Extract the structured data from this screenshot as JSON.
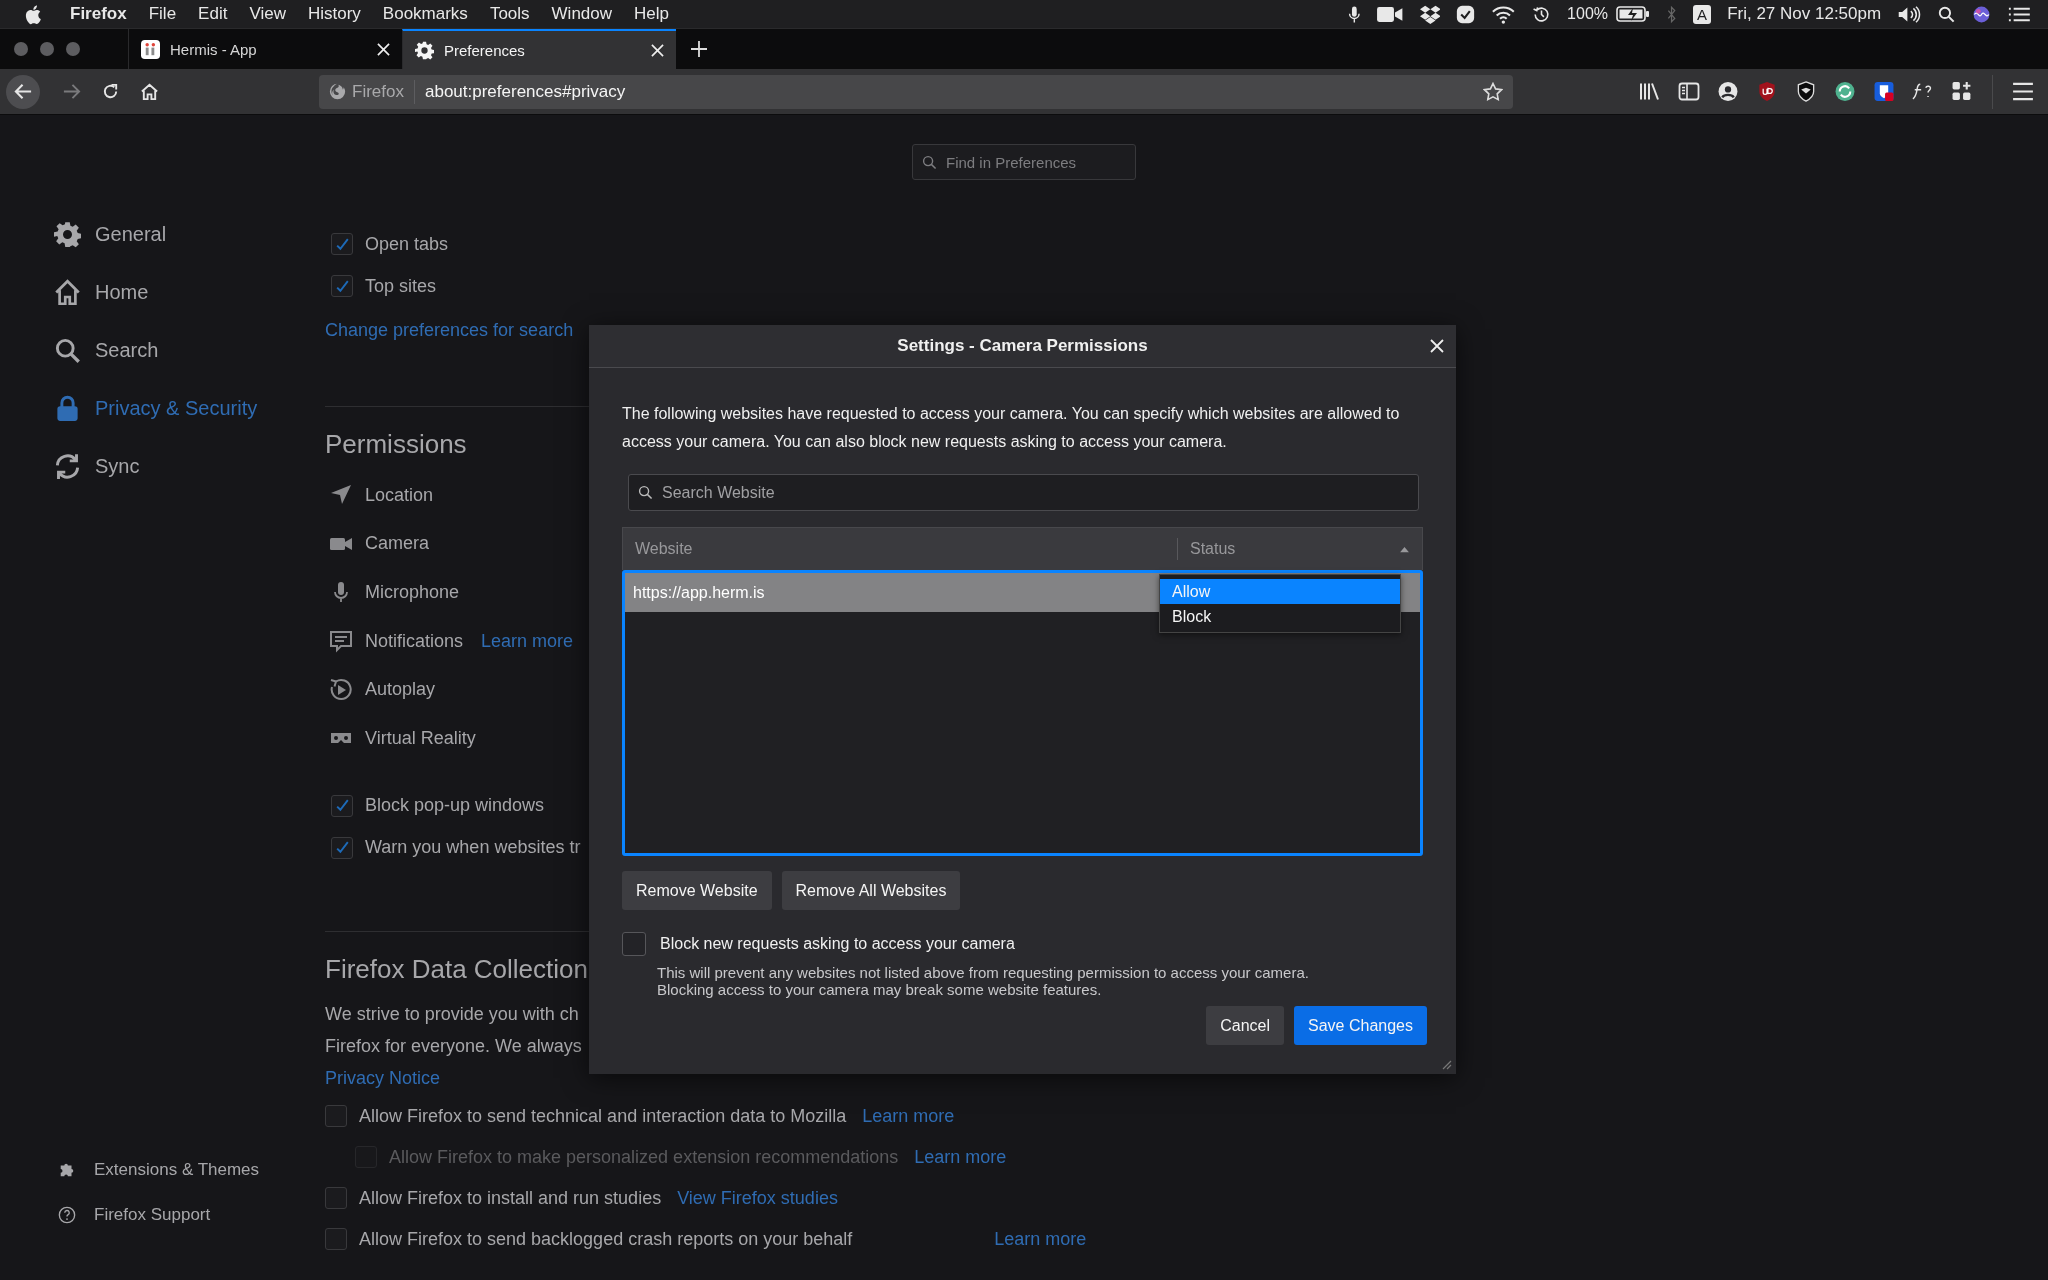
{
  "menu_bar": {
    "app": "Firefox",
    "menus": [
      "File",
      "Edit",
      "View",
      "History",
      "Bookmarks",
      "Tools",
      "Window",
      "Help"
    ],
    "battery": "100%",
    "input_source": "A",
    "clock": "Fri, 27 Nov 12:50pm"
  },
  "tabs": [
    {
      "title": "Hermis - App",
      "selected": false
    },
    {
      "title": "Preferences",
      "selected": true
    }
  ],
  "toolbar": {
    "identity": "Firefox",
    "url": "about:preferences#privacy"
  },
  "find_field": {
    "placeholder": "Find in Preferences"
  },
  "sidebar": {
    "items": [
      {
        "label": "General",
        "selected": false
      },
      {
        "label": "Home",
        "selected": false
      },
      {
        "label": "Search",
        "selected": false
      },
      {
        "label": "Privacy & Security",
        "selected": true
      },
      {
        "label": "Sync",
        "selected": false
      }
    ],
    "footer": [
      "Extensions & Themes",
      "Firefox Support"
    ]
  },
  "content": {
    "home_options": [
      {
        "label": "Open tabs",
        "checked": true
      },
      {
        "label": "Top sites",
        "checked": true
      }
    ],
    "search_link": "Change preferences for search",
    "permissions": {
      "heading": "Permissions",
      "items": [
        {
          "label": "Location"
        },
        {
          "label": "Camera"
        },
        {
          "label": "Microphone"
        },
        {
          "label": "Notifications",
          "link": "Learn more"
        },
        {
          "label": "Autoplay"
        },
        {
          "label": "Virtual Reality"
        }
      ],
      "options": [
        {
          "label": "Block pop-up windows",
          "checked": true
        },
        {
          "label": "Warn you when websites tr",
          "checked": true
        }
      ]
    },
    "data_collection": {
      "heading": "Firefox Data Collection",
      "lines": [
        "We strive to provide you with ch",
        "Firefox for everyone. We always"
      ],
      "privacy_notice": "Privacy Notice",
      "options": [
        {
          "label": "Allow Firefox to send technical and interaction data to Mozilla",
          "checked": false,
          "disabled": false,
          "link": "Learn more",
          "nested": false
        },
        {
          "label": "Allow Firefox to make personalized extension recommendations",
          "checked": false,
          "disabled": true,
          "link": "Learn more",
          "nested": true
        },
        {
          "label": "Allow Firefox to install and run studies",
          "checked": false,
          "disabled": false,
          "link": "View Firefox studies",
          "nested": false
        },
        {
          "label": "Allow Firefox to send backlogged crash reports on your behalf",
          "checked": false,
          "disabled": false,
          "link": "Learn more",
          "nested": false
        }
      ]
    }
  },
  "dialog": {
    "title": "Settings - Camera Permissions",
    "description": "The following websites have requested to access your camera. You can specify which websites are allowed to access your camera. You can also block new requests asking to access your camera.",
    "search": {
      "placeholder": "Search Website"
    },
    "columns": [
      "Website",
      "Status"
    ],
    "rows": [
      {
        "website": "https://app.herm.is",
        "selected": true
      }
    ],
    "status_options": [
      {
        "label": "Allow",
        "selected": true
      },
      {
        "label": "Block",
        "selected": false
      }
    ],
    "list_buttons": [
      "Remove Website",
      "Remove All Websites"
    ],
    "block_new": {
      "label": "Block new requests asking to access your camera",
      "checked": false,
      "note_lines": [
        "This will prevent any websites not listed above from requesting permission to access your camera.",
        "Blocking access to your camera may break some website features."
      ]
    },
    "buttons": [
      {
        "label": "Cancel",
        "kind": "secondary"
      },
      {
        "label": "Save Changes",
        "kind": "primary"
      }
    ]
  }
}
